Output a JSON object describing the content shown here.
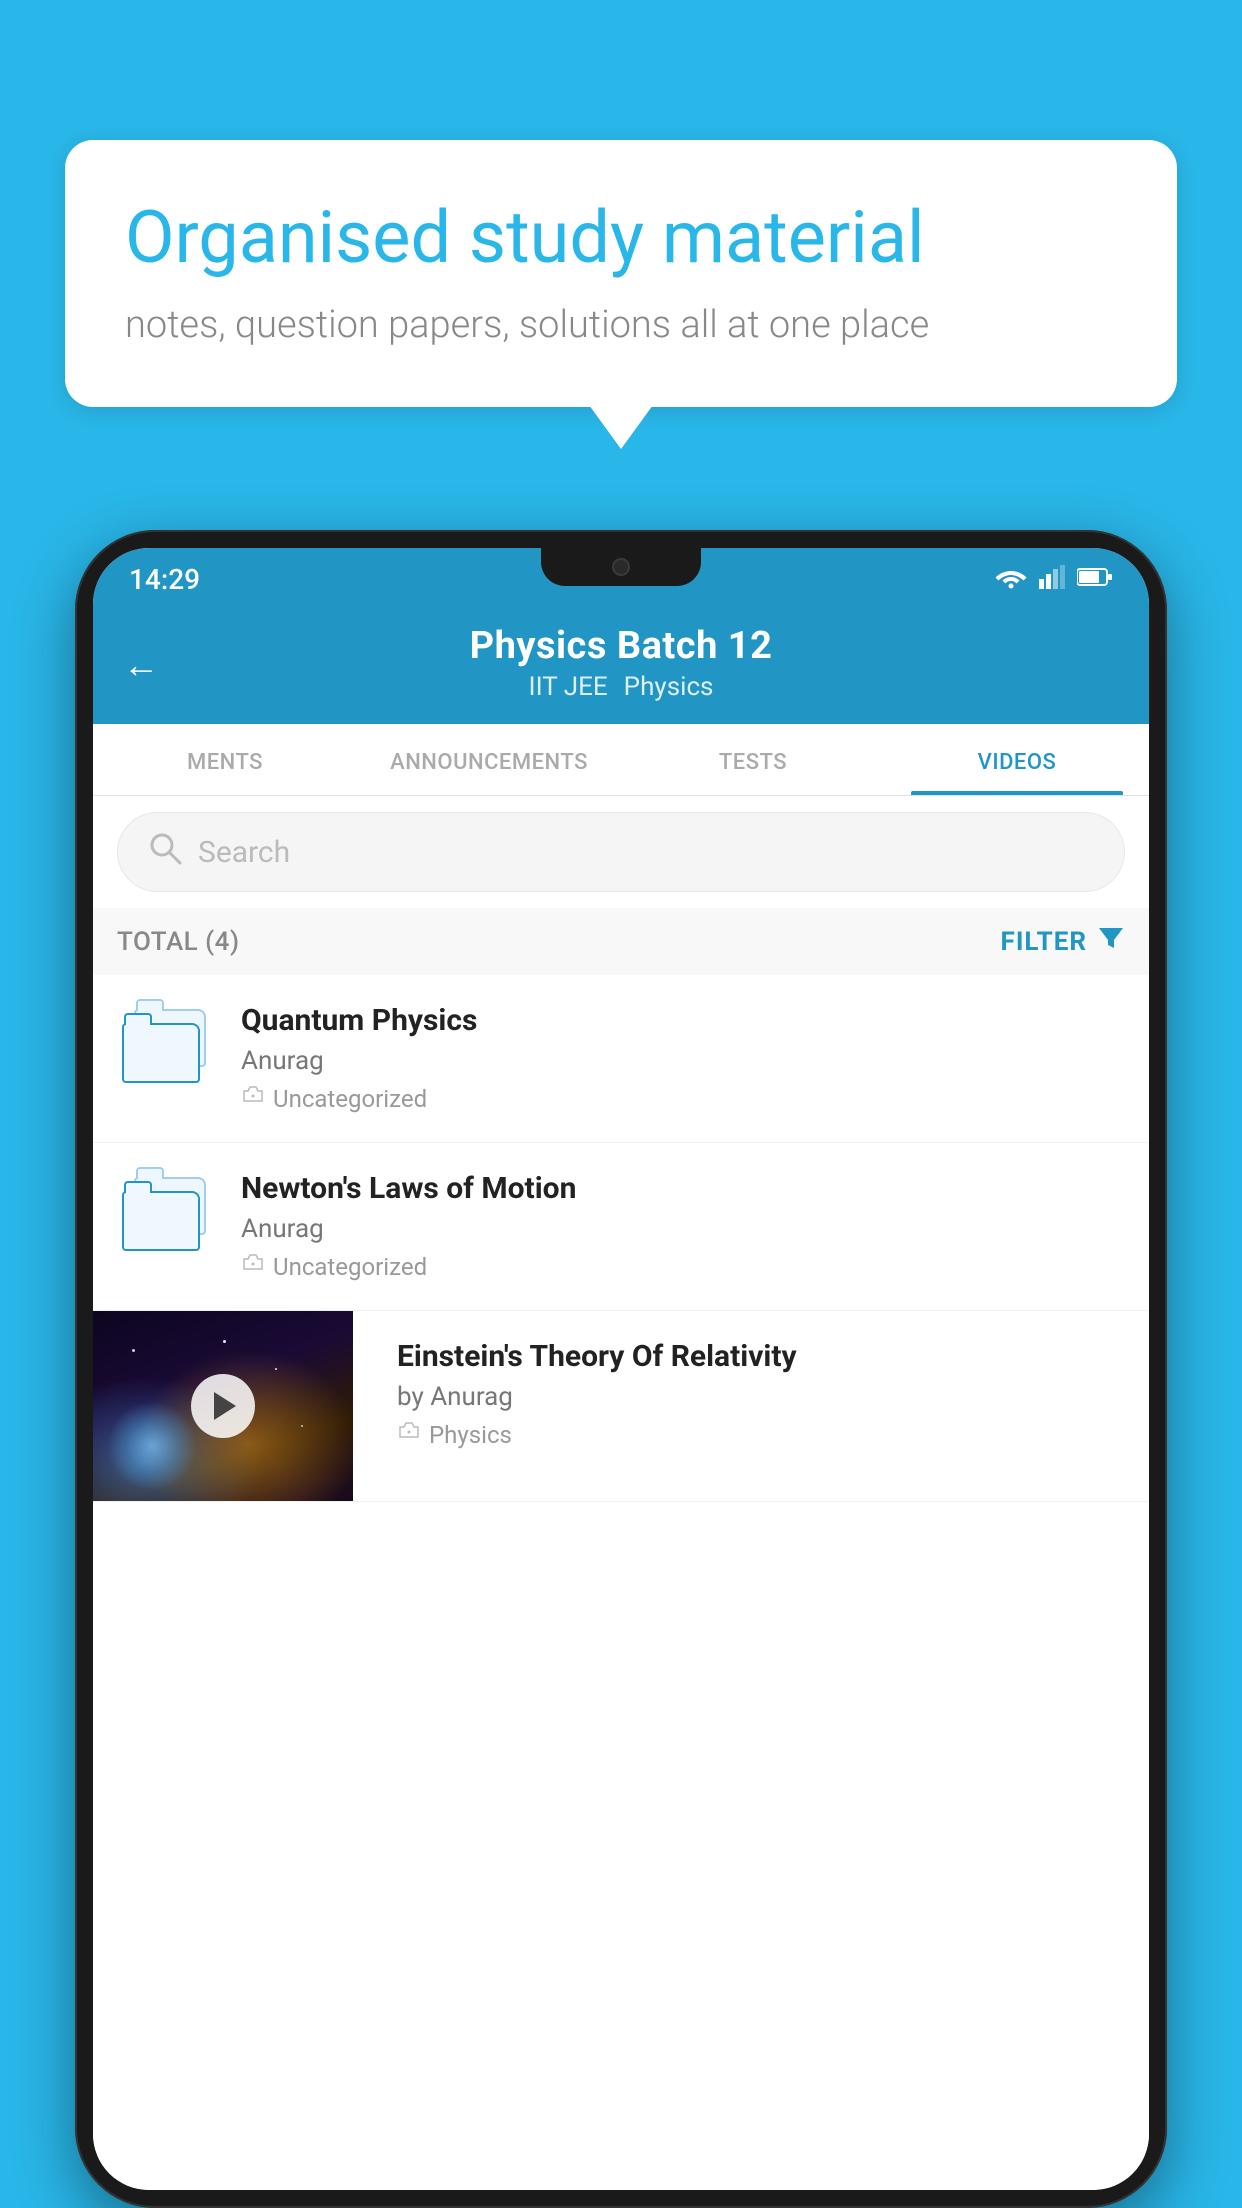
{
  "background_color": "#29b6e8",
  "speech_bubble": {
    "title": "Organised study material",
    "subtitle": "notes, question papers, solutions all at one place"
  },
  "phone": {
    "status_bar": {
      "time": "14:29",
      "wifi": "▾",
      "signal": "▲",
      "battery": "▮"
    },
    "header": {
      "title": "Physics Batch 12",
      "tag1": "IIT JEE",
      "tag2": "Physics",
      "back_label": "←"
    },
    "tabs": [
      {
        "label": "MENTS",
        "active": false
      },
      {
        "label": "ANNOUNCEMENTS",
        "active": false
      },
      {
        "label": "TESTS",
        "active": false
      },
      {
        "label": "VIDEOS",
        "active": true
      }
    ],
    "search": {
      "placeholder": "Search"
    },
    "filter": {
      "total_label": "TOTAL (4)",
      "filter_label": "FILTER"
    },
    "videos": [
      {
        "id": 1,
        "title": "Quantum Physics",
        "author": "Anurag",
        "tag": "Uncategorized",
        "has_thumbnail": false
      },
      {
        "id": 2,
        "title": "Newton's Laws of Motion",
        "author": "Anurag",
        "tag": "Uncategorized",
        "has_thumbnail": false
      },
      {
        "id": 3,
        "title": "Einstein's Theory Of Relativity",
        "author": "by Anurag",
        "tag": "Physics",
        "has_thumbnail": true
      }
    ]
  }
}
